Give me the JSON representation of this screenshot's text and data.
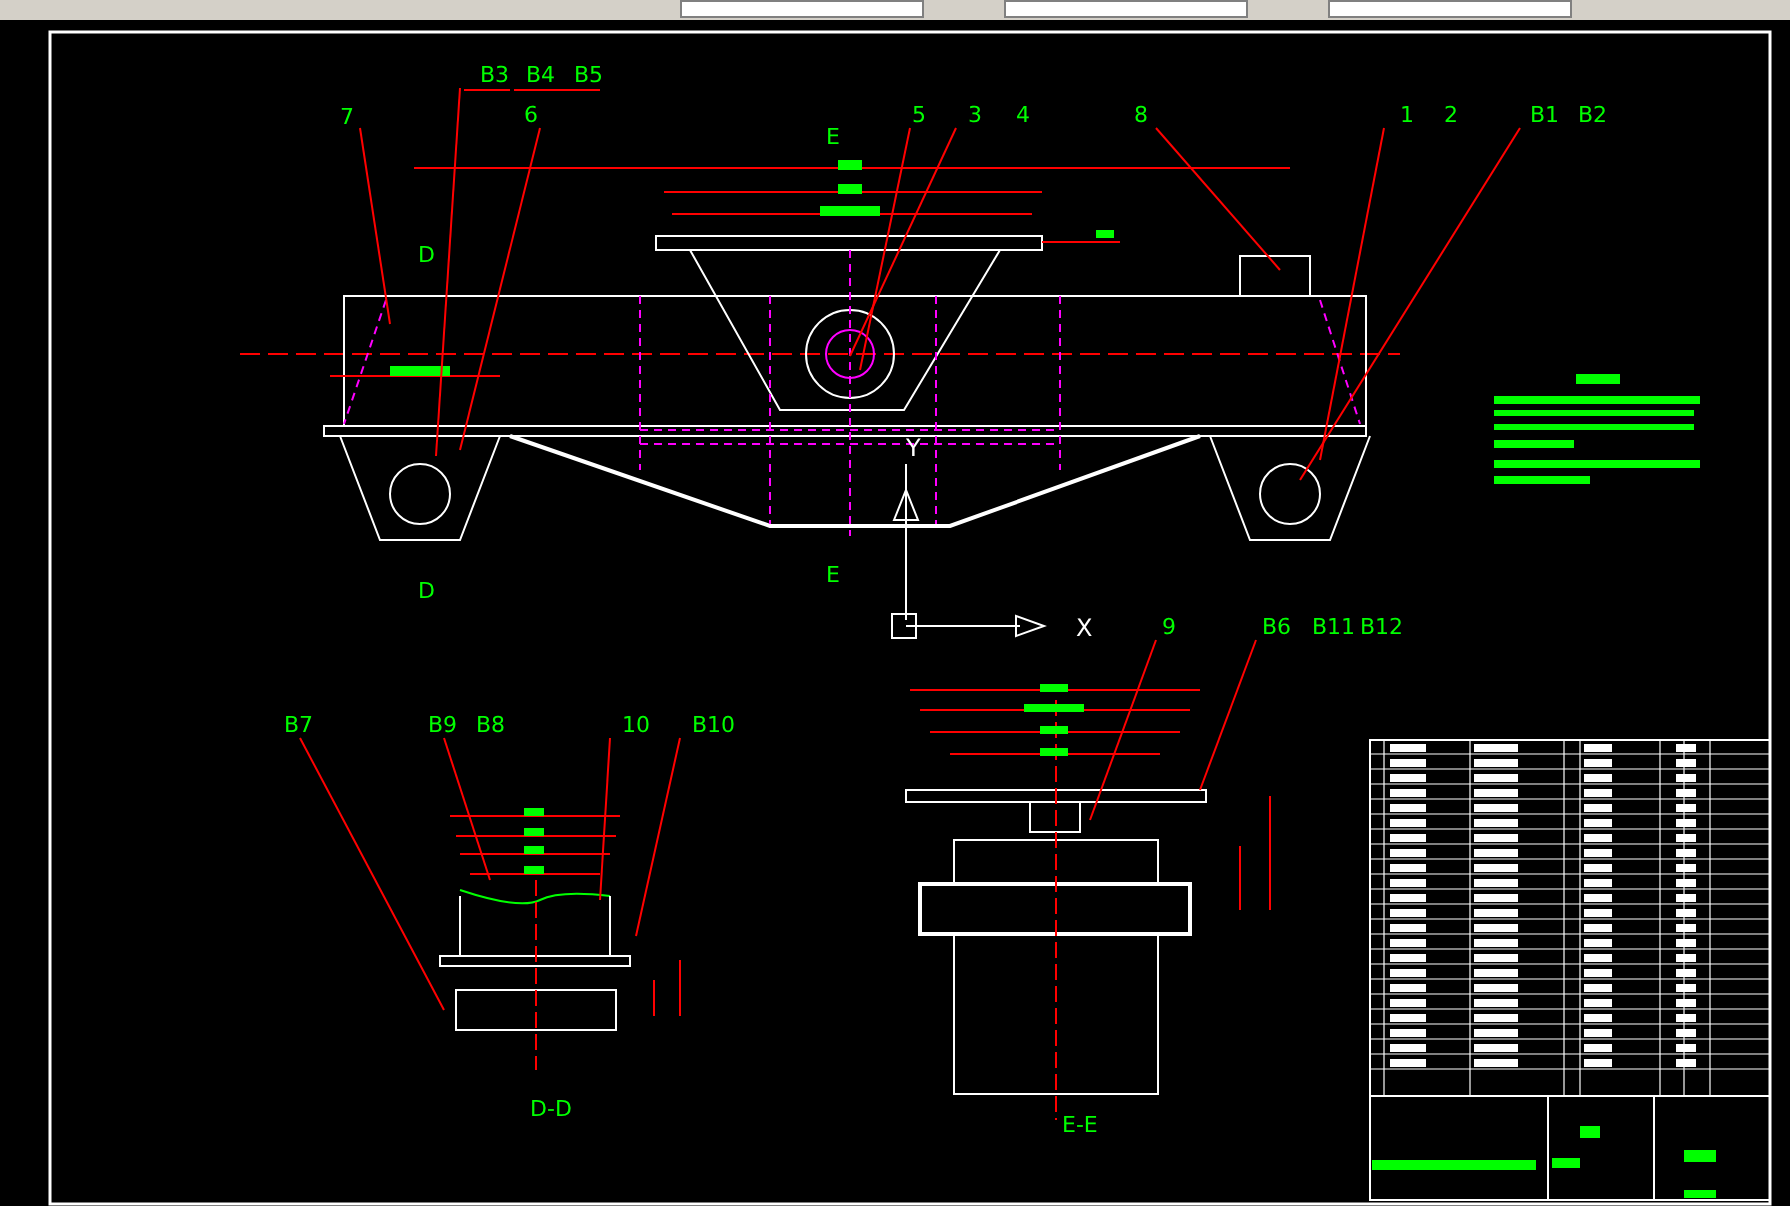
{
  "drawing": {
    "callouts": [
      "7",
      "B3",
      "B4",
      "B5",
      "6",
      "5",
      "3",
      "4",
      "8",
      "1",
      "2",
      "B1",
      "B2",
      "9",
      "B6",
      "B11",
      "B12",
      "B7",
      "B9",
      "B8",
      "10",
      "B10"
    ],
    "section_marks": [
      "E",
      "E",
      "D",
      "D"
    ],
    "axis_labels": [
      "Y",
      "X"
    ],
    "view_titles": [
      "D-D",
      "E-E"
    ]
  }
}
